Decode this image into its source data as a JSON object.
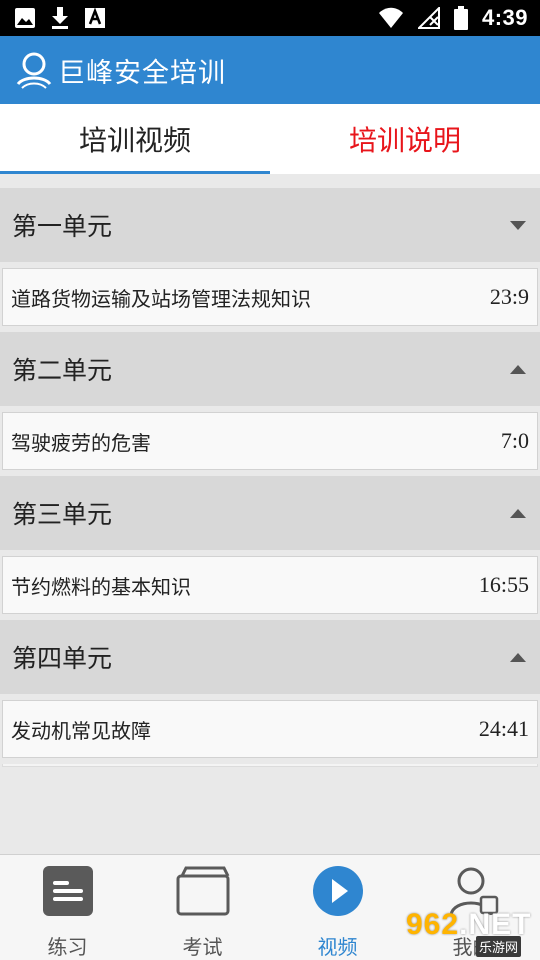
{
  "status_bar": {
    "icons": [
      "image-icon",
      "download-icon",
      "a-box-icon"
    ],
    "right_icons": [
      "wifi-icon",
      "signal-icon",
      "battery-icon"
    ],
    "time": "4:39"
  },
  "app_bar": {
    "title": "巨峰安全培训",
    "logo_icon": "person-globe-logo",
    "color": "#2f86d0"
  },
  "tabs": [
    {
      "label": "培训视频",
      "active": true
    },
    {
      "label": "培训说明",
      "active": false,
      "color": "#e8151b"
    }
  ],
  "units": [
    {
      "title": "第一单元",
      "expanded": false,
      "arrow": "chevron-down-icon",
      "videos": [
        {
          "title": "道路货物运输及站场管理法规知识",
          "duration": "23:9"
        }
      ]
    },
    {
      "title": "第二单元",
      "expanded": true,
      "arrow": "chevron-up-icon",
      "videos": [
        {
          "title": "驾驶疲劳的危害",
          "duration": "7:0"
        }
      ]
    },
    {
      "title": "第三单元",
      "expanded": true,
      "arrow": "chevron-up-icon",
      "videos": [
        {
          "title": "节约燃料的基本知识",
          "duration": "16:55"
        }
      ]
    },
    {
      "title": "第四单元",
      "expanded": true,
      "arrow": "chevron-up-icon",
      "videos": [
        {
          "title": "发动机常见故障",
          "duration": "24:41"
        }
      ]
    }
  ],
  "bottom_nav": [
    {
      "label": "练习",
      "icon": "list-icon",
      "active": false
    },
    {
      "label": "考试",
      "icon": "folder-icon",
      "active": false
    },
    {
      "label": "视频",
      "icon": "play-circle-icon",
      "active": true
    },
    {
      "label": "我的",
      "icon": "user-icon",
      "active": false
    }
  ],
  "watermark": {
    "brand_num": "962",
    "brand_suffix": ".NET",
    "sub": "乐游网"
  }
}
